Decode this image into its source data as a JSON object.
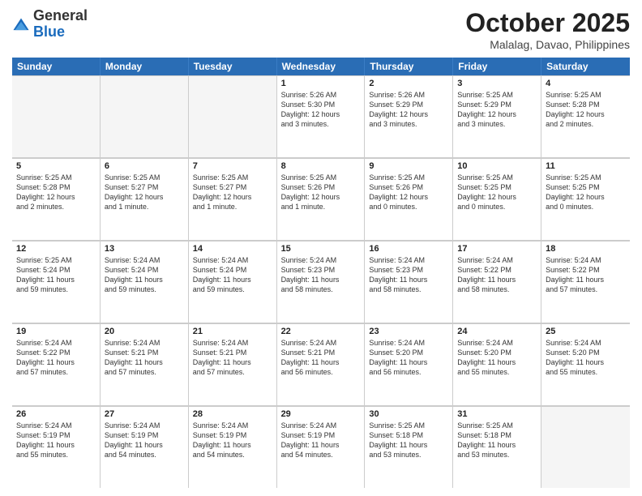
{
  "header": {
    "logo": {
      "general": "General",
      "blue": "Blue"
    },
    "title": "October 2025",
    "location": "Malalag, Davao, Philippines"
  },
  "weekdays": [
    "Sunday",
    "Monday",
    "Tuesday",
    "Wednesday",
    "Thursday",
    "Friday",
    "Saturday"
  ],
  "rows": [
    [
      {
        "day": "",
        "text": "",
        "empty": true
      },
      {
        "day": "",
        "text": "",
        "empty": true
      },
      {
        "day": "",
        "text": "",
        "empty": true
      },
      {
        "day": "1",
        "text": "Sunrise: 5:26 AM\nSunset: 5:30 PM\nDaylight: 12 hours\nand 3 minutes.",
        "empty": false
      },
      {
        "day": "2",
        "text": "Sunrise: 5:26 AM\nSunset: 5:29 PM\nDaylight: 12 hours\nand 3 minutes.",
        "empty": false
      },
      {
        "day": "3",
        "text": "Sunrise: 5:25 AM\nSunset: 5:29 PM\nDaylight: 12 hours\nand 3 minutes.",
        "empty": false
      },
      {
        "day": "4",
        "text": "Sunrise: 5:25 AM\nSunset: 5:28 PM\nDaylight: 12 hours\nand 2 minutes.",
        "empty": false
      }
    ],
    [
      {
        "day": "5",
        "text": "Sunrise: 5:25 AM\nSunset: 5:28 PM\nDaylight: 12 hours\nand 2 minutes.",
        "empty": false
      },
      {
        "day": "6",
        "text": "Sunrise: 5:25 AM\nSunset: 5:27 PM\nDaylight: 12 hours\nand 1 minute.",
        "empty": false
      },
      {
        "day": "7",
        "text": "Sunrise: 5:25 AM\nSunset: 5:27 PM\nDaylight: 12 hours\nand 1 minute.",
        "empty": false
      },
      {
        "day": "8",
        "text": "Sunrise: 5:25 AM\nSunset: 5:26 PM\nDaylight: 12 hours\nand 1 minute.",
        "empty": false
      },
      {
        "day": "9",
        "text": "Sunrise: 5:25 AM\nSunset: 5:26 PM\nDaylight: 12 hours\nand 0 minutes.",
        "empty": false
      },
      {
        "day": "10",
        "text": "Sunrise: 5:25 AM\nSunset: 5:25 PM\nDaylight: 12 hours\nand 0 minutes.",
        "empty": false
      },
      {
        "day": "11",
        "text": "Sunrise: 5:25 AM\nSunset: 5:25 PM\nDaylight: 12 hours\nand 0 minutes.",
        "empty": false
      }
    ],
    [
      {
        "day": "12",
        "text": "Sunrise: 5:25 AM\nSunset: 5:24 PM\nDaylight: 11 hours\nand 59 minutes.",
        "empty": false
      },
      {
        "day": "13",
        "text": "Sunrise: 5:24 AM\nSunset: 5:24 PM\nDaylight: 11 hours\nand 59 minutes.",
        "empty": false
      },
      {
        "day": "14",
        "text": "Sunrise: 5:24 AM\nSunset: 5:24 PM\nDaylight: 11 hours\nand 59 minutes.",
        "empty": false
      },
      {
        "day": "15",
        "text": "Sunrise: 5:24 AM\nSunset: 5:23 PM\nDaylight: 11 hours\nand 58 minutes.",
        "empty": false
      },
      {
        "day": "16",
        "text": "Sunrise: 5:24 AM\nSunset: 5:23 PM\nDaylight: 11 hours\nand 58 minutes.",
        "empty": false
      },
      {
        "day": "17",
        "text": "Sunrise: 5:24 AM\nSunset: 5:22 PM\nDaylight: 11 hours\nand 58 minutes.",
        "empty": false
      },
      {
        "day": "18",
        "text": "Sunrise: 5:24 AM\nSunset: 5:22 PM\nDaylight: 11 hours\nand 57 minutes.",
        "empty": false
      }
    ],
    [
      {
        "day": "19",
        "text": "Sunrise: 5:24 AM\nSunset: 5:22 PM\nDaylight: 11 hours\nand 57 minutes.",
        "empty": false
      },
      {
        "day": "20",
        "text": "Sunrise: 5:24 AM\nSunset: 5:21 PM\nDaylight: 11 hours\nand 57 minutes.",
        "empty": false
      },
      {
        "day": "21",
        "text": "Sunrise: 5:24 AM\nSunset: 5:21 PM\nDaylight: 11 hours\nand 57 minutes.",
        "empty": false
      },
      {
        "day": "22",
        "text": "Sunrise: 5:24 AM\nSunset: 5:21 PM\nDaylight: 11 hours\nand 56 minutes.",
        "empty": false
      },
      {
        "day": "23",
        "text": "Sunrise: 5:24 AM\nSunset: 5:20 PM\nDaylight: 11 hours\nand 56 minutes.",
        "empty": false
      },
      {
        "day": "24",
        "text": "Sunrise: 5:24 AM\nSunset: 5:20 PM\nDaylight: 11 hours\nand 55 minutes.",
        "empty": false
      },
      {
        "day": "25",
        "text": "Sunrise: 5:24 AM\nSunset: 5:20 PM\nDaylight: 11 hours\nand 55 minutes.",
        "empty": false
      }
    ],
    [
      {
        "day": "26",
        "text": "Sunrise: 5:24 AM\nSunset: 5:19 PM\nDaylight: 11 hours\nand 55 minutes.",
        "empty": false
      },
      {
        "day": "27",
        "text": "Sunrise: 5:24 AM\nSunset: 5:19 PM\nDaylight: 11 hours\nand 54 minutes.",
        "empty": false
      },
      {
        "day": "28",
        "text": "Sunrise: 5:24 AM\nSunset: 5:19 PM\nDaylight: 11 hours\nand 54 minutes.",
        "empty": false
      },
      {
        "day": "29",
        "text": "Sunrise: 5:24 AM\nSunset: 5:19 PM\nDaylight: 11 hours\nand 54 minutes.",
        "empty": false
      },
      {
        "day": "30",
        "text": "Sunrise: 5:25 AM\nSunset: 5:18 PM\nDaylight: 11 hours\nand 53 minutes.",
        "empty": false
      },
      {
        "day": "31",
        "text": "Sunrise: 5:25 AM\nSunset: 5:18 PM\nDaylight: 11 hours\nand 53 minutes.",
        "empty": false
      },
      {
        "day": "",
        "text": "",
        "empty": true
      }
    ]
  ]
}
